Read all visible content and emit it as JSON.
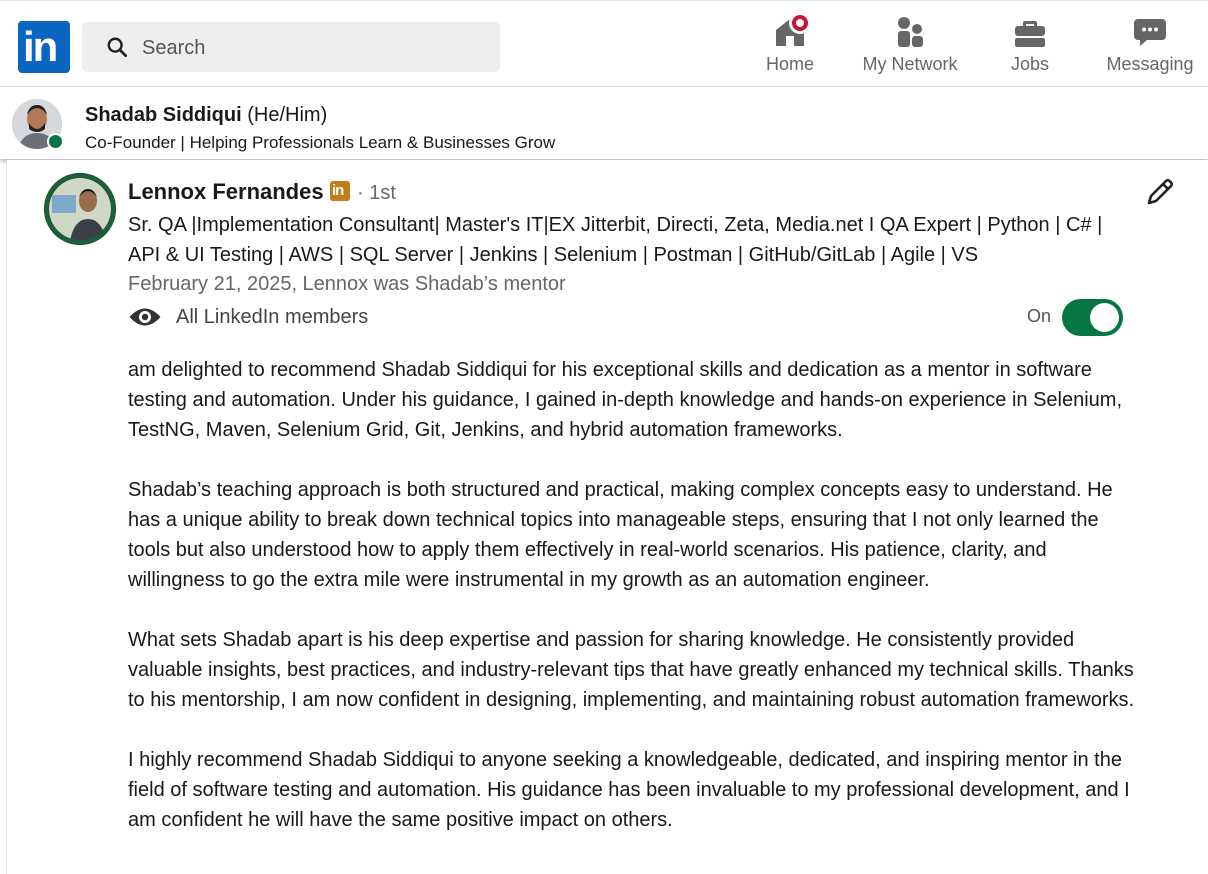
{
  "nav": {
    "logo_text": "in",
    "search_placeholder": "Search",
    "items": [
      {
        "label": "Home",
        "icon": "home-icon",
        "has_badge": true
      },
      {
        "label": "My Network",
        "icon": "people-icon"
      },
      {
        "label": "Jobs",
        "icon": "briefcase-icon"
      },
      {
        "label": "Messaging",
        "icon": "chat-icon"
      }
    ]
  },
  "profile": {
    "name": "Shadab Siddiqui",
    "pronouns": "(He/Him)",
    "headline": "Co-Founder | Helping Professionals Learn & Businesses Grow",
    "status": "online",
    "status_color": "#057642"
  },
  "recommendation": {
    "recommender_name": "Lennox Fernandes",
    "badge": "in",
    "degree": "· 1st",
    "headline": "Sr. QA |Implementation Consultant| Master's IT|EX Jitterbit, Directi, Zeta, Media.net I QA Expert | Python | C# | API & UI Testing | AWS | SQL Server | Jenkins | Selenium | Postman | GitHub/GitLab | Agile | VS",
    "date_relation": "February 21, 2025, Lennox was Shadab’s mentor",
    "visibility": "All LinkedIn members",
    "toggle_label": "On",
    "toggle_on": true,
    "paragraphs": [
      "am delighted to recommend Shadab Siddiqui for his exceptional skills and dedication as a mentor in software testing and automation. Under his guidance, I gained in-depth knowledge and hands-on experience in Selenium, TestNG, Maven, Selenium Grid, Git, Jenkins, and hybrid automation frameworks.",
      "Shadab’s teaching approach is both structured and practical, making complex concepts easy to understand. He has a unique ability to break down technical topics into manageable steps, ensuring that I not only learned the tools but also understood how to apply them effectively in real-world scenarios. His patience, clarity, and willingness to go the extra mile were instrumental in my growth as an automation engineer.",
      "What sets Shadab apart is his deep expertise and passion for sharing knowledge. He consistently provided valuable insights, best practices, and industry-relevant tips that have greatly enhanced my technical skills. Thanks to his mentorship, I am now confident in designing, implementing, and maintaining robust automation frameworks.",
      "I highly recommend Shadab Siddiqui to anyone seeking a knowledgeable, dedicated, and inspiring mentor in the field of software testing and automation. His guidance has been invaluable to my professional development, and I am confident he will have the same positive impact on others."
    ]
  },
  "colors": {
    "brand": "#0a66c2",
    "toggle_on": "#057642",
    "notification": "#cb112d",
    "premium_badge": "#c37d16"
  }
}
